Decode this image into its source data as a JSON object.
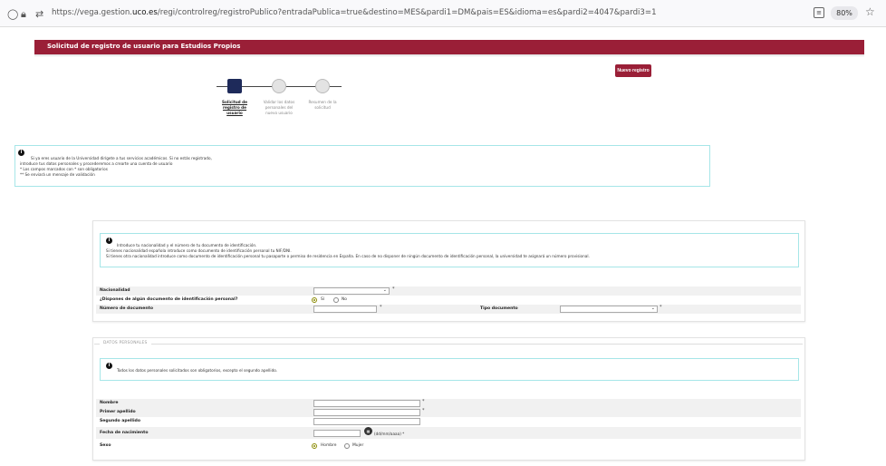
{
  "browser": {
    "url_prefix": "https://vega.gestion.",
    "url_domain": "uco.es",
    "url_suffix": "/regi/controlreg/registroPublico?entradaPublica=true&destino=MES&pardi1=DM&pais=ES&idioma=es&pardi2=4047&pardi3=1",
    "zoom": "80%"
  },
  "header": {
    "title": "Solicitud de registro de usuario para Estudios Propios"
  },
  "new_record_button": "Nuevo registro",
  "stepper": [
    {
      "line1": "Solicitud de",
      "line2": "registro de",
      "line3": "usuario",
      "active": true
    },
    {
      "line1": "Validar los datos",
      "line2": "personales del",
      "line3": "nuevo usuario",
      "active": false
    },
    {
      "line1": "Resumen de la",
      "line2": "solicitud",
      "line3": "",
      "active": false
    }
  ],
  "top_info": {
    "line1": "Si ya eres usuario de la Universidad dirígete a tus servicios académicos. Si no estás registrado,",
    "line2": "introduce tus datos personales y procederemos a crearte una cuenta de usuario",
    "line3": "* Los campos marcados con * son obligatorios",
    "line4": "** Se enviará un mensaje de validación"
  },
  "id_info": {
    "line1": "Introduce tu nacionalidad y el número de tu documento de identificación.",
    "line2": "Si tienes nacionalidad española introduce como documento de identificación personal tu NIF/DNI.",
    "line3": "Si tienes otra nacionalidad introduce como documento de identificación personal tu pasaporte o permiso de residencia en España. En caso de no disponer de ningún documento de identificación personal, la universidad te asignará un número provisional."
  },
  "id_form": {
    "nationality_label": "Nacionalidad",
    "has_document_label": "¿Dispones de algún documento de identificación personal?",
    "yes": "Sí",
    "no": "No",
    "doc_number_label": "Número de documento",
    "doc_type_label": "Tipo documento",
    "required_mark": "*"
  },
  "personal": {
    "legend": "DATOS PERSONALES",
    "info": "Todos los datos personales solicitados son obligatorios, excepto el segundo apellido.",
    "name_label": "Nombre",
    "surname1_label": "Primer apellido",
    "surname2_label": "Segundo apellido",
    "birth_label": "Fecha de nacimiento",
    "birth_hint": "(dd/mm/aaaa) *",
    "sex_label": "Sexo",
    "male": "Hombre",
    "female": "Mujer"
  }
}
